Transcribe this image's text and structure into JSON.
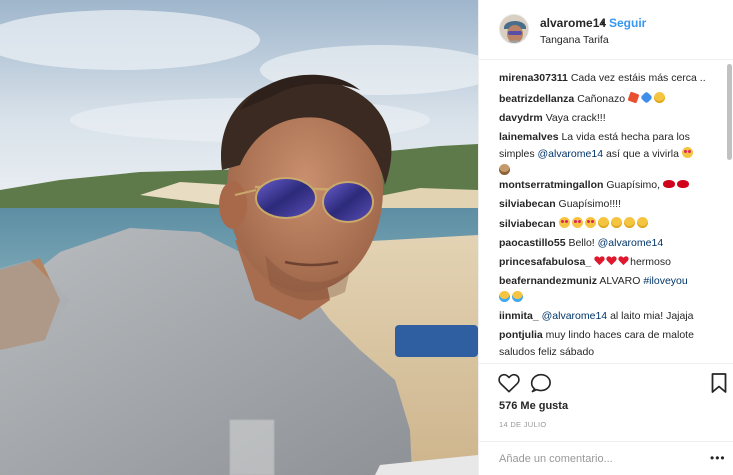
{
  "post": {
    "username": "alvarome14",
    "separator": "•",
    "follow_label": "Seguir",
    "location": "Tangana Tarifa",
    "likes": "576 Me gusta",
    "date": "14 DE JULIO",
    "add_comment_placeholder": "Añade un comentario...",
    "more_label": "•••"
  },
  "comments": [
    {
      "user": "mirena307311",
      "text": "Cada vez estáis más cerca ..",
      "emojis": []
    },
    {
      "user": "beatrizdellanza",
      "text": "Cañonazo",
      "emojis": [
        "boom-emoji",
        "blue-heart-emoji",
        "face-emoji"
      ]
    },
    {
      "user": "davydrm",
      "text": "Vaya crack!!!",
      "emojis": []
    },
    {
      "user": "lainemalves",
      "text": "La vida está hecha para los simples",
      "mention": "@alvarome14",
      "text2": "así que a vivirla",
      "emojis": [
        "heart-eyes-emoji",
        "monkey-emoji"
      ]
    },
    {
      "user": "montserratmingallon",
      "text": "Guapísimo,",
      "emojis": [
        "lips-emoji",
        "lips-emoji"
      ]
    },
    {
      "user": "silviabecan",
      "text": "Guapísimo!!!!",
      "emojis": []
    },
    {
      "user": "silviabecan",
      "text": "",
      "emojis": [
        "heart-eyes-emoji",
        "heart-eyes-emoji",
        "heart-eyes-emoji",
        "kiss-emoji",
        "kiss-emoji",
        "kiss-emoji",
        "kiss-emoji"
      ]
    },
    {
      "user": "paocastillo55",
      "text": "Bello!",
      "mention": "@alvarome14",
      "emojis": []
    },
    {
      "user": "princesafabulosa_",
      "text": "hermoso",
      "emojis": [
        "red-heart-emoji",
        "red-heart-emoji",
        "red-heart-emoji"
      ]
    },
    {
      "user": "beafernandezmuniz",
      "text": "ALVARO",
      "mention": "#iloveyou",
      "emojis": [
        "laugh-emoji",
        "laugh-emoji"
      ]
    },
    {
      "user": "iinmita_",
      "text": "",
      "mention": "@alvarome14",
      "text2": "al laito mia! Jajaja",
      "emojis": []
    },
    {
      "user": "pontjulia",
      "text": "muy lindo haces cara de malote saludos feliz sábado",
      "emojis": []
    }
  ],
  "icons": {
    "like": "heart-outline-icon",
    "comment": "speech-bubble-icon",
    "save": "bookmark-icon",
    "more": "ellipsis-icon"
  },
  "colors": {
    "link_blue": "#3897f0",
    "mention_blue": "#003569",
    "text": "#262626",
    "muted": "#999999",
    "divider": "#efefef"
  }
}
